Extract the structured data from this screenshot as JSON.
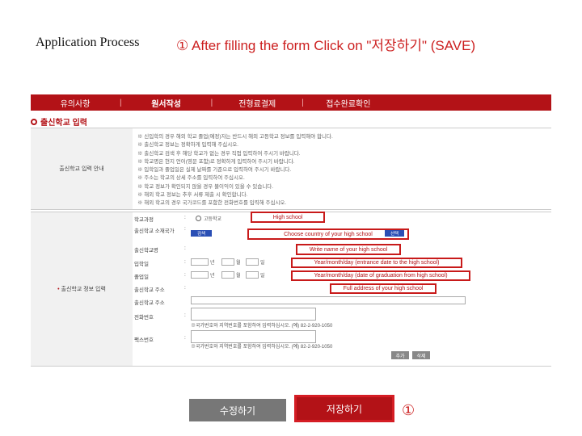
{
  "slide": {
    "title_left": "Application Process",
    "title_right": "① After filling the form Click on \"저장하기\" (SAVE)"
  },
  "nav": {
    "tabs": [
      "유의사항",
      "원서작성",
      "전형료결제",
      "접수완료확인"
    ],
    "separator": "|"
  },
  "section": {
    "title": "출신학교 입력",
    "notes_label": "출신학교 입력 안내",
    "form_label": "출신학교 정보 입력",
    "notes": [
      "※ 신입학의 경우 해외 학교 졸업(예정)자는 반드시 해외 고등학교 정보를 입력해야 합니다.",
      "※ 출신학교 정보는 정확하게 입력해 주십시오.",
      "※ 출신학교 검색 후 해당 학교가 없는 경우 직접 입력하여 주시기 바랍니다.",
      "※ 학교명은 현지 언어(영문 포함)로 정확하게 입력하여 주시기 바랍니다.",
      "※ 입학일과 졸업일은 실제 날짜를 기준으로 입력하여 주시기 바랍니다.",
      "※ 주소는 학교의 상세 주소를 입력하여 주십시오.",
      "※ 학교 정보가 확인되지 않을 경우 불이익이 있을 수 있습니다.",
      "※ 해외 학교 정보는 추후 서류 제출 시 확인합니다.",
      "※ 해외 학교의 경우 국가코드를 포함한 전화번호를 입력해 주십시오."
    ]
  },
  "form": {
    "rows": [
      {
        "label": "학교과정",
        "colon": ":"
      },
      {
        "label": "출신학교 소재국가",
        "colon": ":"
      },
      {
        "label": "출신학교명",
        "colon": ":"
      },
      {
        "label": "입학일",
        "colon": ":"
      },
      {
        "label": "졸업일",
        "colon": ":"
      },
      {
        "label": "출신학교 주소",
        "colon": ":"
      },
      {
        "label": "출신학교 주소",
        "colon": ""
      },
      {
        "label": "전화번호",
        "colon": ":"
      },
      {
        "label": "팩스번호",
        "colon": ":"
      }
    ],
    "radio_label": "고등학교",
    "search_btn": "검색",
    "select_btn": "선택",
    "year": "년",
    "month": "월",
    "day": "일",
    "highlights": {
      "school_type": "High school",
      "country": "Choose country of your high school",
      "school_name": "Write name of your high school",
      "entrance": "Year/month/day (entrance date to the high school)",
      "graduation": "Year/month/day (date of graduation from high school)",
      "address": "Full address of your high school"
    },
    "phone_note": "※국가번호와 지역번호를 포함하여 입력하십시오. (예) 82-2-920-1050",
    "fax_note": "※국가번호와 지역번호를 포함하여 입력하십시오. (예) 82-2-920-1050",
    "add_btn": "추가",
    "delete_btn": "삭제"
  },
  "buttons": {
    "edit": "수정하기",
    "save": "저장하기",
    "marker": "①"
  },
  "colors": {
    "brand_red": "#b31217",
    "highlight_red": "#c81a1a"
  }
}
